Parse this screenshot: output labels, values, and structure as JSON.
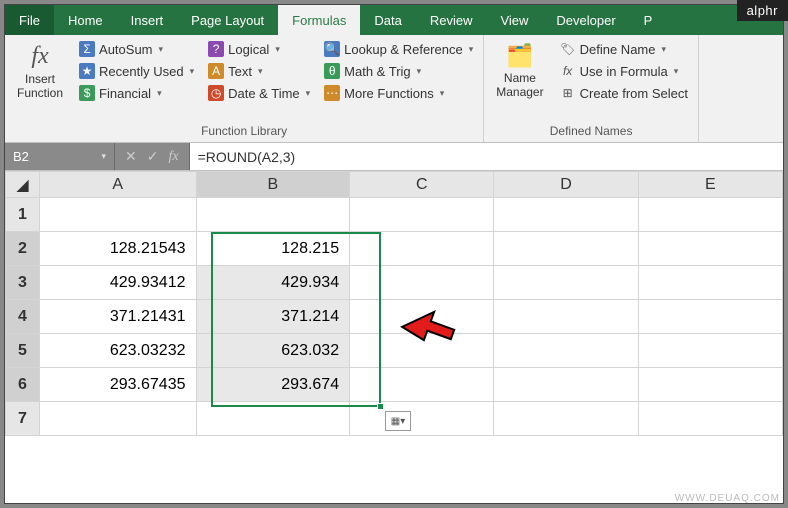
{
  "tabs": {
    "file": "File",
    "home": "Home",
    "insert": "Insert",
    "page_layout": "Page Layout",
    "formulas": "Formulas",
    "data": "Data",
    "review": "Review",
    "view": "View",
    "developer": "Developer",
    "last": "P"
  },
  "ribbon": {
    "insert_function": "Insert\nFunction",
    "autosum": "AutoSum",
    "recently_used": "Recently Used",
    "financial": "Financial",
    "logical": "Logical",
    "text": "Text",
    "date_time": "Date & Time",
    "lookup": "Lookup & Reference",
    "math_trig": "Math & Trig",
    "more_functions": "More Functions",
    "function_library": "Function Library",
    "name_manager": "Name\nManager",
    "define_name": "Define Name",
    "use_in_formula": "Use in Formula",
    "create_selection": "Create from Select",
    "defined_names": "Defined Names"
  },
  "namebox": "B2",
  "formula": "=ROUND(A2,3)",
  "columns": [
    "A",
    "B",
    "C",
    "D",
    "E"
  ],
  "rows": [
    "1",
    "2",
    "3",
    "4",
    "5",
    "6",
    "7"
  ],
  "chart_data": {
    "type": "table",
    "columns": [
      "A",
      "B"
    ],
    "rows": [
      {
        "A": 128.21543,
        "B": 128.215
      },
      {
        "A": 429.93412,
        "B": 429.934
      },
      {
        "A": 371.21431,
        "B": 371.214
      },
      {
        "A": 623.03232,
        "B": 623.032
      },
      {
        "A": 293.67435,
        "B": 293.674
      }
    ]
  },
  "cells": {
    "A2": "128.21543",
    "B2": "128.215",
    "A3": "429.93412",
    "B3": "429.934",
    "A4": "371.21431",
    "B4": "371.214",
    "A5": "623.03232",
    "B5": "623.032",
    "A6": "293.67435",
    "B6": "293.674"
  },
  "brand": "alphr",
  "watermark": "WWW.DEUAQ.COM"
}
